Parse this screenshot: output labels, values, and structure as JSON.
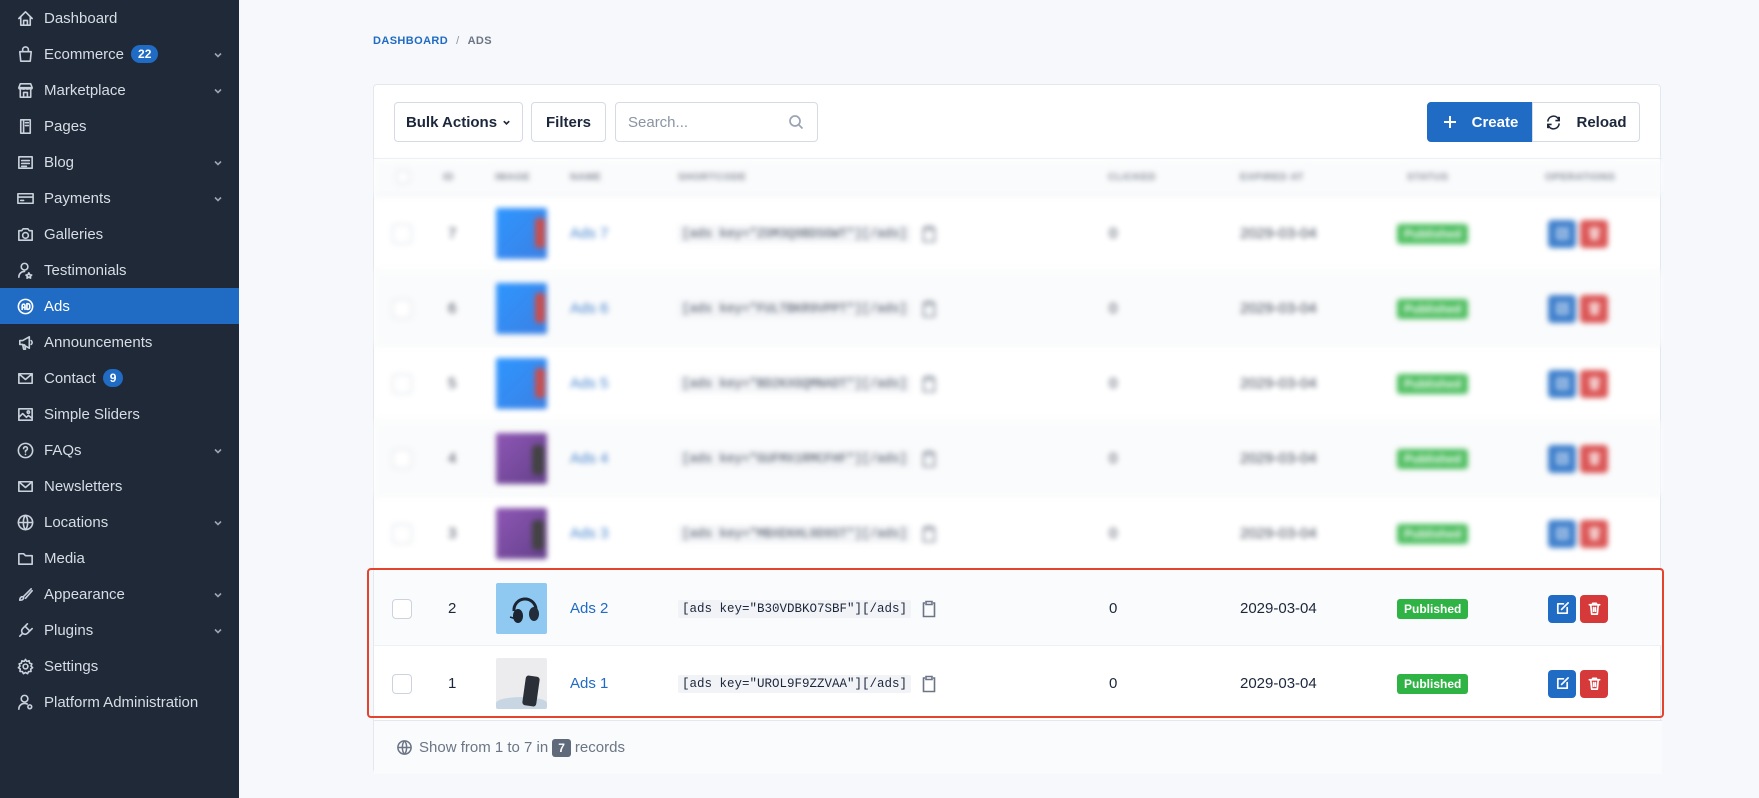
{
  "sidebar": {
    "items": [
      {
        "label": "Dashboard",
        "icon": "home-icon"
      },
      {
        "label": "Ecommerce",
        "icon": "shopping-bag-icon",
        "badge": "22",
        "chevron": true
      },
      {
        "label": "Marketplace",
        "icon": "store-icon",
        "chevron": true
      },
      {
        "label": "Pages",
        "icon": "page-icon"
      },
      {
        "label": "Blog",
        "icon": "list-icon",
        "chevron": true
      },
      {
        "label": "Payments",
        "icon": "credit-card-icon",
        "chevron": true
      },
      {
        "label": "Galleries",
        "icon": "camera-icon"
      },
      {
        "label": "Testimonials",
        "icon": "user-star-icon"
      },
      {
        "label": "Ads",
        "icon": "ad-circle-icon",
        "active": true
      },
      {
        "label": "Announcements",
        "icon": "speakerphone-icon"
      },
      {
        "label": "Contact",
        "icon": "mail-icon",
        "badge": "9"
      },
      {
        "label": "Simple Sliders",
        "icon": "photo-icon"
      },
      {
        "label": "FAQs",
        "icon": "help-circle-icon",
        "chevron": true
      },
      {
        "label": "Newsletters",
        "icon": "mail-icon"
      },
      {
        "label": "Locations",
        "icon": "globe-icon",
        "chevron": true
      },
      {
        "label": "Media",
        "icon": "folder-icon"
      },
      {
        "label": "Appearance",
        "icon": "brush-icon",
        "chevron": true
      },
      {
        "label": "Plugins",
        "icon": "plug-icon",
        "chevron": true
      },
      {
        "label": "Settings",
        "icon": "gear-icon"
      },
      {
        "label": "Platform Administration",
        "icon": "user-cog-icon"
      }
    ]
  },
  "breadcrumb": {
    "home": "DASHBOARD",
    "separator": "/",
    "current": "ADS"
  },
  "toolbar": {
    "bulk_label": "Bulk Actions",
    "filters_label": "Filters",
    "search_placeholder": "Search...",
    "create_label": "Create",
    "reload_label": "Reload"
  },
  "table": {
    "headers": [
      "ID",
      "IMAGE",
      "NAME",
      "SHORTCODE",
      "CLICKED",
      "EXPIRED AT",
      "STATUS",
      "OPERATIONS"
    ],
    "rows": [
      {
        "id": "7",
        "name": "Ads 7",
        "shortcode": "[ads key=\"ZOM3Q9BDSGWT\"][/ads]",
        "clicked": "0",
        "expired": "2029-03-04",
        "status": "Published",
        "image": "blue",
        "blurred": true
      },
      {
        "id": "6",
        "name": "Ads 6",
        "shortcode": "[ads key=\"FULTBKR9VPPT\"][/ads]",
        "clicked": "0",
        "expired": "2029-03-04",
        "status": "Published",
        "image": "blue",
        "blurred": true
      },
      {
        "id": "5",
        "name": "Ads 5",
        "shortcode": "[ads key=\"BD2KXGQMNADT\"][/ads]",
        "clicked": "0",
        "expired": "2029-03-04",
        "status": "Published",
        "image": "blue",
        "blurred": true
      },
      {
        "id": "4",
        "name": "Ads 4",
        "shortcode": "[ads key=\"GUFMX1RMCFHF\"][/ads]",
        "clicked": "0",
        "expired": "2029-03-04",
        "status": "Published",
        "image": "purple",
        "blurred": true
      },
      {
        "id": "3",
        "name": "Ads 3",
        "shortcode": "[ads key=\"MBXEKHL9D9ST\"][/ads]",
        "clicked": "0",
        "expired": "2029-03-04",
        "status": "Published",
        "image": "purple",
        "blurred": true
      },
      {
        "id": "2",
        "name": "Ads 2",
        "shortcode": "[ads key=\"B30VDBKO7SBF\"][/ads]",
        "clicked": "0",
        "expired": "2029-03-04",
        "status": "Published",
        "image": "headphones",
        "blurred": false
      },
      {
        "id": "1",
        "name": "Ads 1",
        "shortcode": "[ads key=\"UROL9F9ZZVAA\"][/ads]",
        "clicked": "0",
        "expired": "2029-03-04",
        "status": "Published",
        "image": "phone",
        "blurred": false
      }
    ]
  },
  "footer": {
    "prefix": "Show from 1 to 7 in",
    "count": "7",
    "suffix": "records"
  },
  "colors": {
    "primary": "#206bc4",
    "sidebar": "#1f2937",
    "success": "#2fb344",
    "danger": "#d63939",
    "highlight": "#e4432d"
  }
}
